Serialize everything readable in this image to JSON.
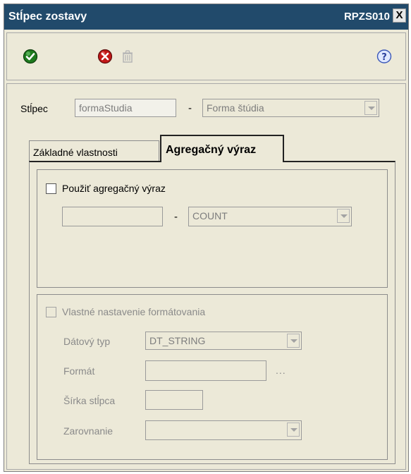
{
  "window": {
    "title": "Stĺpec zostavy",
    "code": "RPZS010",
    "close_glyph": "X"
  },
  "toolbar": {
    "ok_icon": "green-check-icon",
    "cancel_icon": "red-x-icon",
    "delete_icon": "trash-icon",
    "help_icon": "help-icon"
  },
  "column": {
    "label": "Stĺpec",
    "code_value": "formaStudia",
    "separator": "-",
    "name_value": "Forma štúdia"
  },
  "tabs": [
    {
      "label": "Základné vlastnosti",
      "active": false
    },
    {
      "label": "Agregačný výraz",
      "active": true
    }
  ],
  "aggregate": {
    "checkbox_label": "Použiť agregačný výraz",
    "checked": false,
    "expr_value": "",
    "separator": "-",
    "function_value": "COUNT"
  },
  "formatting": {
    "checkbox_label": "Vlastné nastavenie formátovania",
    "checked": false,
    "datatype_label": "Dátový typ",
    "datatype_value": "DT_STRING",
    "format_label": "Formát",
    "format_value": "",
    "format_browse": "...",
    "width_label": "Šírka stĺpca",
    "width_value": "",
    "align_label": "Zarovnanie",
    "align_value": ""
  },
  "colors": {
    "titlebar": "#214a6b",
    "window_bg": "#ece9d8"
  }
}
